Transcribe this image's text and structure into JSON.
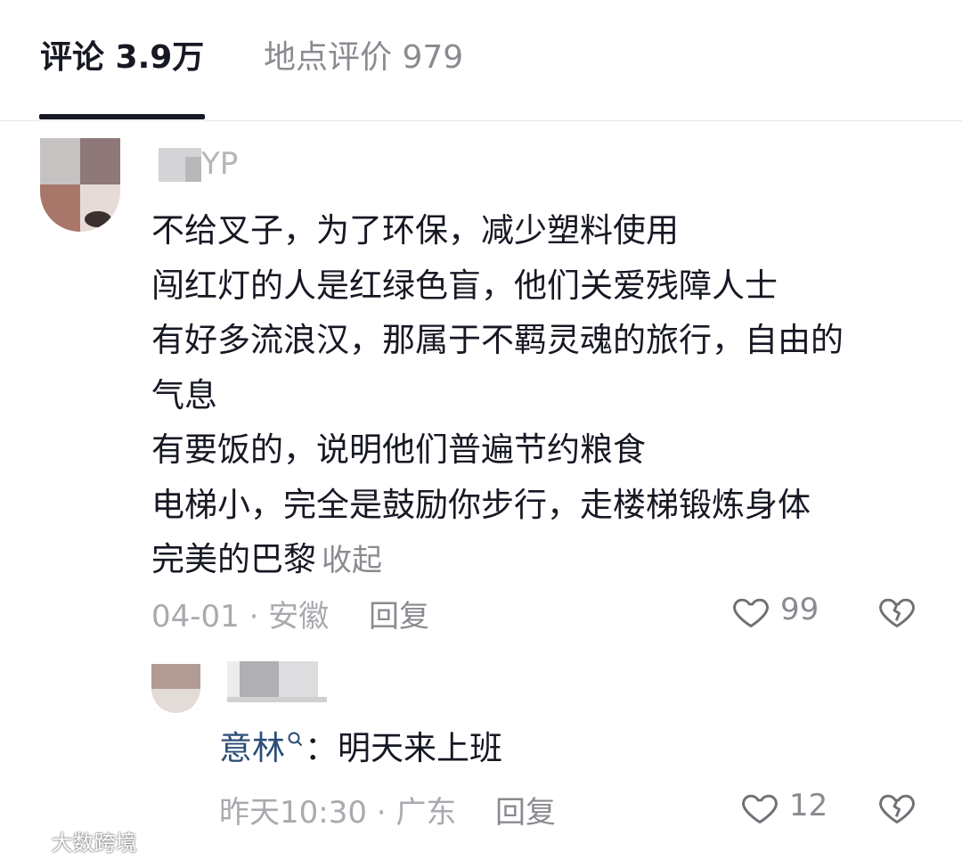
{
  "tabs": [
    {
      "label": "评论 3.9万",
      "active": true
    },
    {
      "label": "地点评价 979",
      "active": false
    }
  ],
  "comment": {
    "username_partial": "YP",
    "lines": [
      "不给叉子，为了环保，减少塑料使用",
      "闯红灯的人是红绿色盲，他们关爱残障人士",
      "有好多流浪汉，那属于不羁灵魂的旅行，自由的",
      "气息",
      "有要饭的，说明他们普遍节约粮食",
      "电梯小，完全是鼓励你步行，走楼梯锻炼身体",
      "完美的巴黎"
    ],
    "collapse_label": "收起",
    "meta": "04-01 · 安徽",
    "reply_label": "回复",
    "likes": "99"
  },
  "reply": {
    "mention_name": "意林",
    "separator": "：",
    "text": "明天来上班",
    "meta": "昨天10:30 · 广东",
    "reply_label": "回复",
    "likes": "12"
  },
  "watermark": "大数跨境",
  "colors": {
    "text": "#161823",
    "secondary": "#8a8b91",
    "meta": "#a9aaaf",
    "mention": "#2c4e78",
    "divider": "#e8e8ea"
  },
  "icons": [
    "heart-outline-icon",
    "broken-heart-icon",
    "search-mention-icon",
    "watermark-logo-icon"
  ]
}
